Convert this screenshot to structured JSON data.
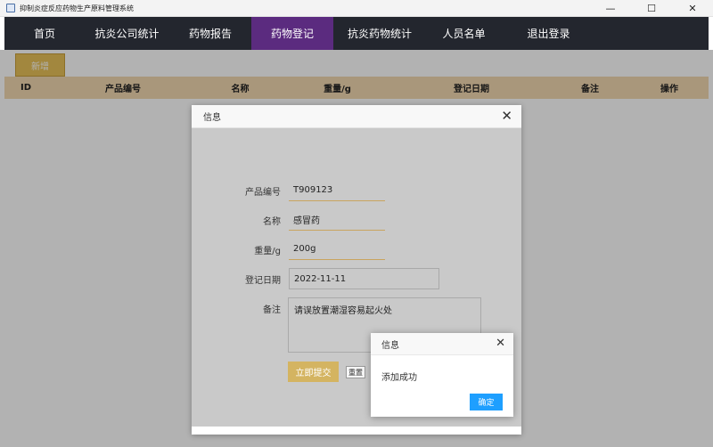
{
  "window": {
    "title": "抑制炎症反应药物生产原料管理系统",
    "minimize": "—",
    "maximize": "☐",
    "close": "✕"
  },
  "nav": {
    "items": [
      {
        "label": "首页"
      },
      {
        "label": "抗炎公司统计"
      },
      {
        "label": "药物报告"
      },
      {
        "label": "药物登记",
        "active": true
      },
      {
        "label": "抗炎药物统计"
      },
      {
        "label": "人员名单"
      },
      {
        "label": "退出登录"
      }
    ]
  },
  "toolbar": {
    "new_label": "新增"
  },
  "table": {
    "headers": [
      "ID",
      "产品编号",
      "名称",
      "重量/g",
      "登记日期",
      "备注",
      "操作"
    ]
  },
  "dialog": {
    "title": "信息",
    "close": "✕",
    "fields": {
      "product_no": {
        "label": "产品编号",
        "value": "T909123"
      },
      "name": {
        "label": "名称",
        "value": "感冒药"
      },
      "weight": {
        "label": "重量/g",
        "value": "200g"
      },
      "date": {
        "label": "登记日期",
        "value": "2022-11-11"
      },
      "remark": {
        "label": "备注",
        "value": "请误放置潮湿容易起火处"
      }
    },
    "submit_label": "立即提交",
    "reset_label": "重置"
  },
  "message": {
    "title": "信息",
    "close": "✕",
    "text": "添加成功",
    "ok_label": "确定"
  },
  "colors": {
    "nav_bg": "#23262e",
    "nav_active": "#5b2b7f",
    "table_head": "#f3d9b1",
    "new_button": "#e8c25a",
    "submit_button": "#d4b461",
    "ok_button": "#1e9fff"
  }
}
